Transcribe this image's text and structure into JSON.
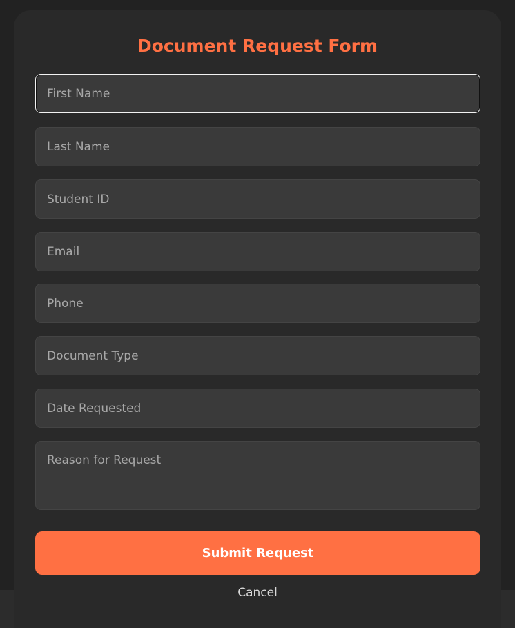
{
  "form": {
    "title": "Document Request Form",
    "fields": {
      "first_name": {
        "placeholder": "First Name",
        "value": ""
      },
      "last_name": {
        "placeholder": "Last Name",
        "value": ""
      },
      "student_id": {
        "placeholder": "Student ID",
        "value": ""
      },
      "email": {
        "placeholder": "Email",
        "value": ""
      },
      "phone": {
        "placeholder": "Phone",
        "value": ""
      },
      "document_type": {
        "placeholder": "Document Type",
        "value": ""
      },
      "date_requested": {
        "placeholder": "Date Requested",
        "value": ""
      },
      "reason": {
        "placeholder": "Reason for Request",
        "value": ""
      }
    },
    "submit_label": "Submit Request",
    "cancel_label": "Cancel"
  },
  "colors": {
    "accent": "#ff7043",
    "page_background": "#222222",
    "card_background": "#292929",
    "field_background": "#3a3a3a"
  }
}
